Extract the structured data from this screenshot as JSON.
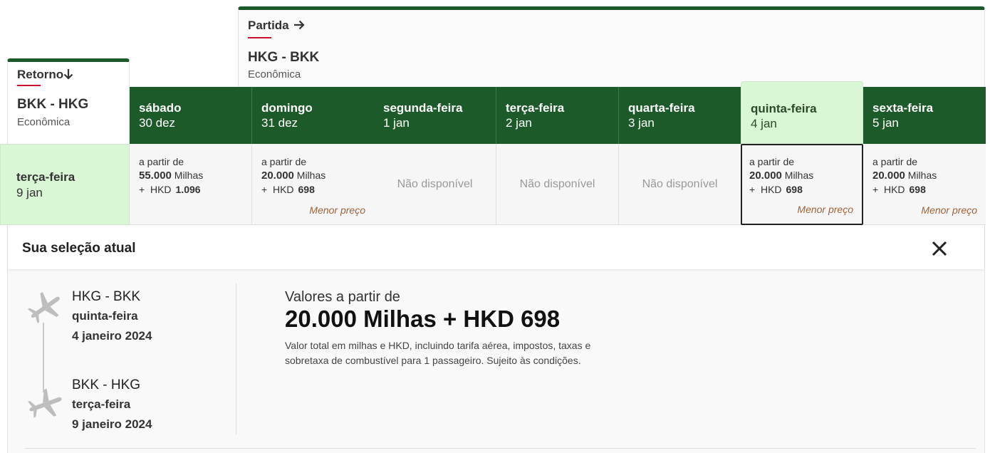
{
  "outbound": {
    "tab_label": "Partida",
    "route": "HKG - BKK",
    "cabin": "Econômica"
  },
  "return": {
    "tab_label": "Retorno",
    "route": "BKK - HKG",
    "cabin": "Econômica"
  },
  "dates": [
    {
      "day": "sábado",
      "date": "30 dez"
    },
    {
      "day": "domingo",
      "date": "31 dez"
    },
    {
      "day": "segunda-feira",
      "date": "1 jan"
    },
    {
      "day": "terça-feira",
      "date": "2 jan"
    },
    {
      "day": "quarta-feira",
      "date": "3 jan"
    },
    {
      "day": "quinta-feira",
      "date": "4 jan"
    },
    {
      "day": "sexta-feira",
      "date": "5 jan"
    }
  ],
  "return_row": {
    "day": "terça-feira",
    "date": "9 jan"
  },
  "prices": [
    {
      "from": "a partir de",
      "miles": "55.000",
      "miles_unit": "Milhas",
      "cash_prefix": "+  HKD",
      "cash": "1.096",
      "tag": ""
    },
    {
      "from": "a partir de",
      "miles": "20.000",
      "miles_unit": "Milhas",
      "cash_prefix": "+  HKD",
      "cash": "698",
      "tag": "Menor preço"
    },
    {
      "na": "Não disponível"
    },
    {
      "na": "Não disponível"
    },
    {
      "na": "Não disponível"
    },
    {
      "from": "a partir de",
      "miles": "20.000",
      "miles_unit": "Milhas",
      "cash_prefix": "+  HKD",
      "cash": "698",
      "tag": "Menor preço"
    },
    {
      "from": "a partir de",
      "miles": "20.000",
      "miles_unit": "Milhas",
      "cash_prefix": "+  HKD",
      "cash": "698",
      "tag": "Menor preço"
    }
  ],
  "selection": {
    "title": "Sua seleção atual",
    "segments": [
      {
        "route": "HKG - BKK",
        "day": "quinta-feira",
        "date": "4 janeiro 2024"
      },
      {
        "route": "BKK - HKG",
        "day": "terça-feira",
        "date": "9 janeiro 2024"
      }
    ],
    "summary_label": "Valores a partir de",
    "summary_amount": "20.000 Milhas + HKD 698",
    "summary_note": "Valor total em milhas e HKD, incluindo tarifa aérea, impostos, taxas e sobretaxa de combustível para 1 passageiro. Sujeito às condições."
  },
  "icons": {
    "outbound_arrow": "arrow-right-icon",
    "return_arrow": "arrow-down-icon",
    "close": "close-icon",
    "plane_takeoff": "plane-icon",
    "plane_landing": "plane-icon"
  },
  "colors": {
    "header_green": "#1d5a2a",
    "selected_green": "#d9f7d4",
    "accent_red": "#c8102e",
    "lowest_price": "#a0623a"
  }
}
